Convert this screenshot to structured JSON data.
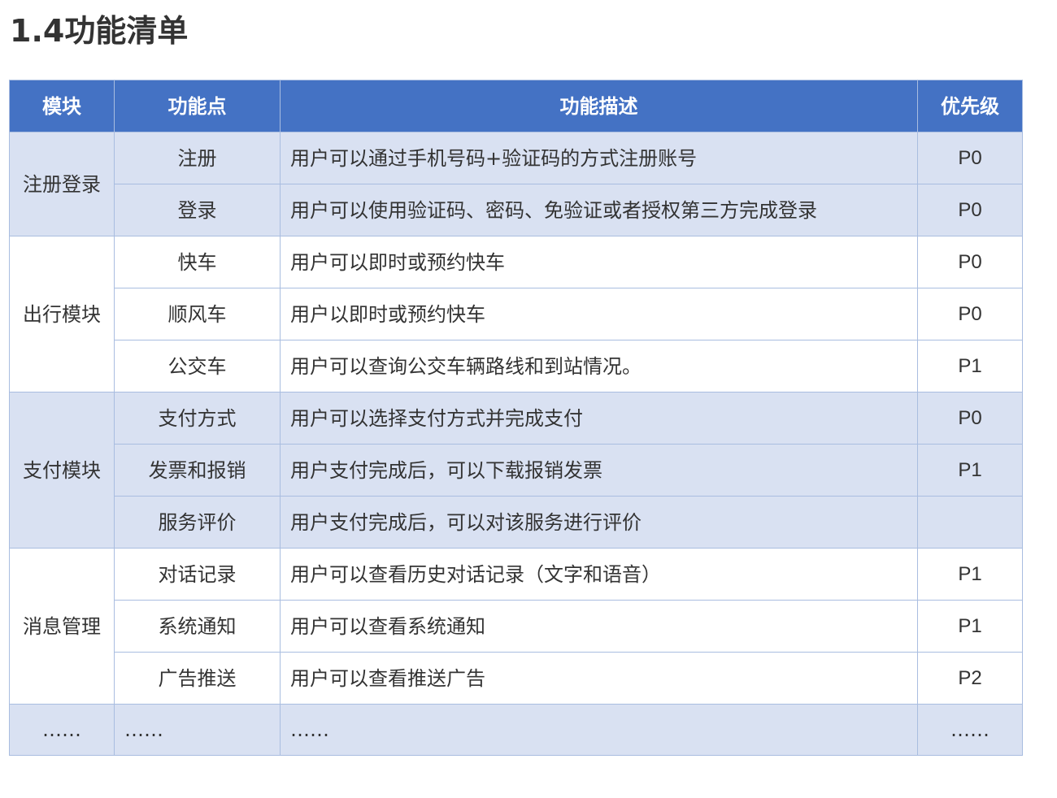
{
  "title": "1.4功能清单",
  "table": {
    "headers": {
      "module": "模块",
      "feature": "功能点",
      "description": "功能描述",
      "priority": "优先级"
    },
    "groups": [
      {
        "module": "注册登录",
        "rows": [
          {
            "feature": "注册",
            "description": "用户可以通过手机号码+验证码的方式注册账号",
            "priority": "P0"
          },
          {
            "feature": "登录",
            "description": "用户可以使用验证码、密码、免验证或者授权第三方完成登录",
            "priority": "P0"
          }
        ]
      },
      {
        "module": "出行模块",
        "rows": [
          {
            "feature": "快车",
            "description": "用户可以即时或预约快车",
            "priority": "P0"
          },
          {
            "feature": "顺风车",
            "description": "用户以即时或预约快车",
            "priority": "P0"
          },
          {
            "feature": "公交车",
            "description": "用户可以查询公交车辆路线和到站情况。",
            "priority": "P1"
          }
        ]
      },
      {
        "module": "支付模块",
        "rows": [
          {
            "feature": "支付方式",
            "description": "用户可以选择支付方式并完成支付",
            "priority": "P0"
          },
          {
            "feature": "发票和报销",
            "description": "用户支付完成后，可以下载报销发票",
            "priority": "P1"
          },
          {
            "feature": "服务评价",
            "description": "用户支付完成后，可以对该服务进行评价",
            "priority": ""
          }
        ]
      },
      {
        "module": "消息管理",
        "rows": [
          {
            "feature": "对话记录",
            "description": "用户可以查看历史对话记录（文字和语音）",
            "priority": "P1"
          },
          {
            "feature": "系统通知",
            "description": "用户可以查看系统通知",
            "priority": "P1"
          },
          {
            "feature": "广告推送",
            "description": "用户可以查看推送广告",
            "priority": "P2"
          }
        ]
      }
    ],
    "ellipsis_row": {
      "module": "……",
      "feature": "……",
      "description": "……",
      "priority": "……"
    }
  },
  "colors": {
    "header_bg": "#4472c4",
    "band_bg": "#d9e1f2",
    "border": "#a9bde0"
  }
}
